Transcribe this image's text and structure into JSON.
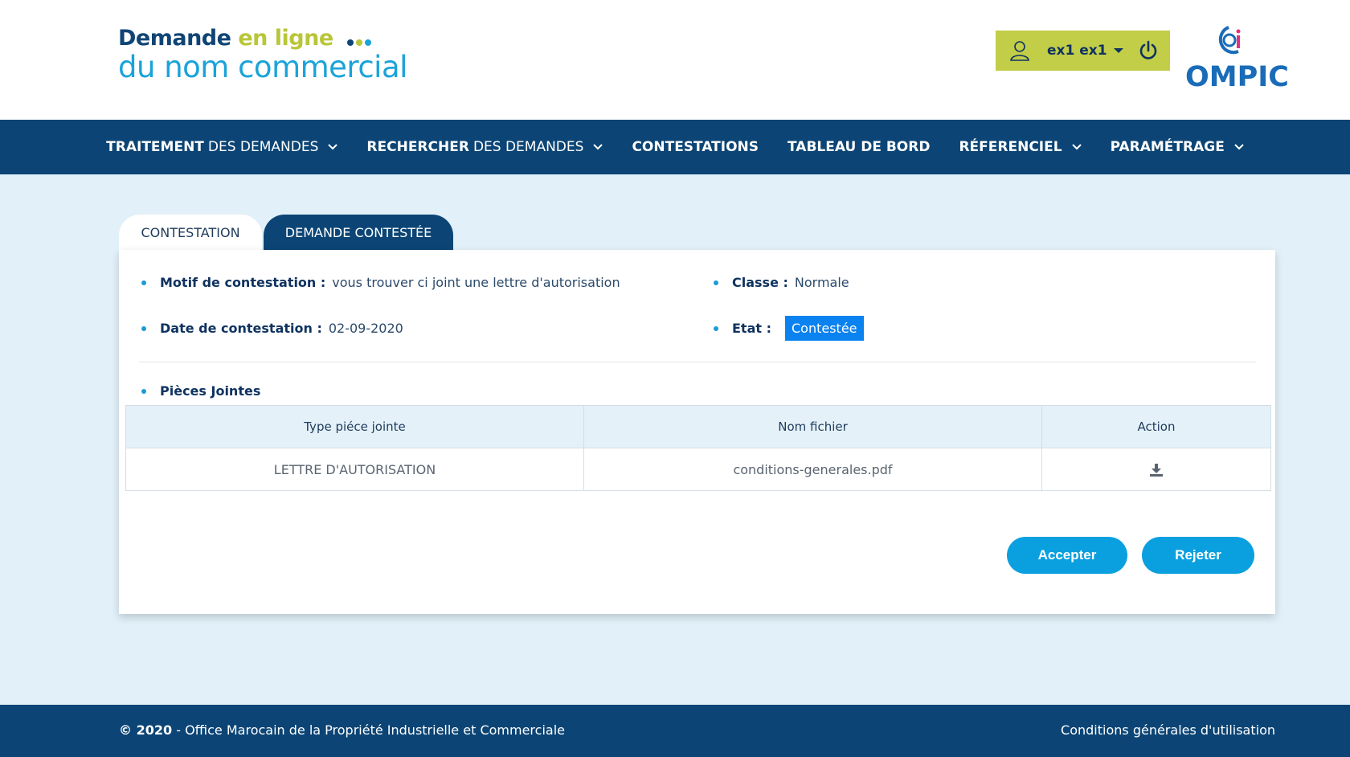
{
  "header": {
    "logo_line1_part1": "Demande",
    "logo_line1_part2": "en ligne",
    "logo_line2": "du nom commercial",
    "user_name": "ex1 ex1",
    "org_logo_text": "OMPIC",
    "colors": {
      "brand_green": "#c2cd48",
      "brand_navy": "#0c4575",
      "brand_blue": "#1aa3d9"
    }
  },
  "nav": {
    "items": [
      {
        "strong": "TRAITEMENT",
        "light": "DES DEMANDES",
        "has_dropdown": true
      },
      {
        "strong": "RECHERCHER",
        "light": "DES DEMANDES",
        "has_dropdown": true
      },
      {
        "strong": "CONTESTATIONS",
        "light": "",
        "has_dropdown": false
      },
      {
        "strong": "TABLEAU DE BORD",
        "light": "",
        "has_dropdown": false
      },
      {
        "strong": "RÉFERENCIEL",
        "light": "",
        "has_dropdown": true
      },
      {
        "strong": "PARAMÉTRAGE",
        "light": "",
        "has_dropdown": true
      }
    ]
  },
  "tabs": {
    "active": "CONTESTATION",
    "other": "DEMANDE CONTESTÉE"
  },
  "details": {
    "motif_label": "Motif de contestation :",
    "motif_value": "vous trouver ci joint une lettre d'autorisation",
    "date_label": "Date de contestation :",
    "date_value": "02-09-2020",
    "classe_label": "Classe :",
    "classe_value": "Normale",
    "etat_label": "Etat :",
    "etat_value": "Contestée",
    "etat_color": "#0a82f0",
    "pieces_label": "Pièces Jointes"
  },
  "table": {
    "headers": [
      "Type piéce jointe",
      "Nom fichier",
      "Action"
    ],
    "rows": [
      {
        "type": "LETTRE D'AUTORISATION",
        "file": "conditions-generales.pdf",
        "action_icon": "download-icon"
      }
    ]
  },
  "actions": {
    "accept": "Accepter",
    "reject": "Rejeter",
    "button_color": "#0aa0e0"
  },
  "footer": {
    "year": "© 2020",
    "org": "- Office Marocain de la Propriété Industrielle et Commerciale",
    "terms": "Conditions générales d'utilisation"
  }
}
